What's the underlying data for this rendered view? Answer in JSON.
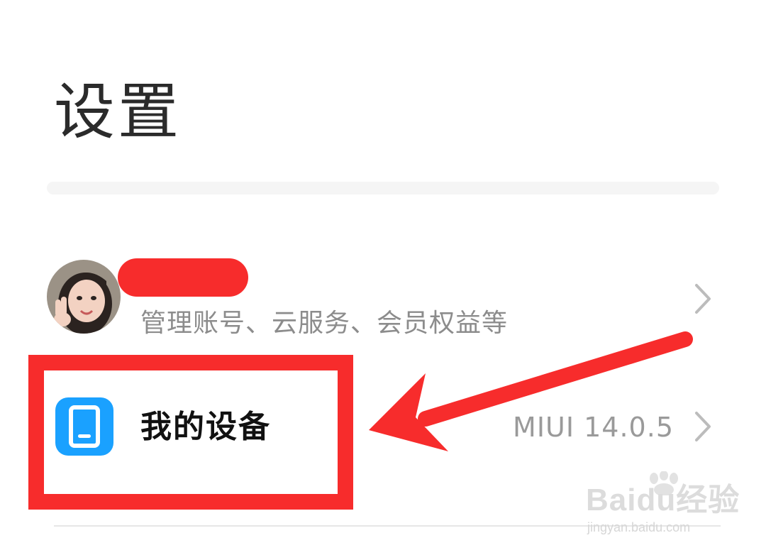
{
  "header": {
    "title": "设置"
  },
  "account": {
    "subtitle": "管理账号、云服务、会员权益等"
  },
  "device": {
    "label": "我的设备",
    "version": "MIUI 14.0.5"
  },
  "watermark": {
    "brand": "Baidu经验",
    "url": "jingyan.baidu.com"
  },
  "colors": {
    "annotation": "#f72c2c",
    "device_icon": "#1aa1ff"
  },
  "icons": {
    "chevron": "chevron-right-icon",
    "device": "tablet-icon"
  }
}
